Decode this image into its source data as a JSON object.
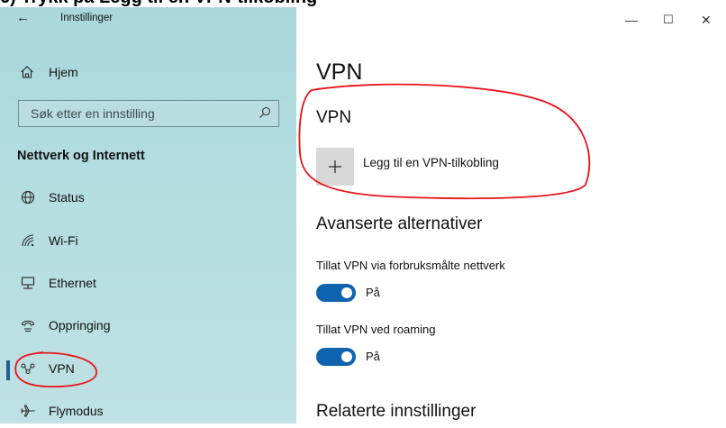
{
  "caption": {
    "text": "6) Trykk på Legg til en VPN-tilkobling"
  },
  "window": {
    "title": "Innstillinger",
    "controls": {
      "minimize": "—",
      "maximize": "☐",
      "close": "✕"
    }
  },
  "sidebar": {
    "home_label": "Hjem",
    "search_placeholder": "Søk etter en innstilling",
    "section_title": "Nettverk og Internett",
    "items": [
      {
        "label": "Status",
        "icon": "globe-icon"
      },
      {
        "label": "Wi-Fi",
        "icon": "wifi-icon"
      },
      {
        "label": "Ethernet",
        "icon": "ethernet-icon"
      },
      {
        "label": "Oppringing",
        "icon": "dialup-icon"
      },
      {
        "label": "VPN",
        "icon": "vpn-icon",
        "active": true
      },
      {
        "label": "Flymodus",
        "icon": "airplane-icon"
      }
    ]
  },
  "main": {
    "page_title": "VPN",
    "vpn_section_title": "VPN",
    "add_vpn_label": "Legg til en VPN-tilkobling",
    "advanced_title": "Avanserte alternativer",
    "options": [
      {
        "label": "Tillat VPN via forbruksmålte nettverk",
        "state": "På",
        "on": true
      },
      {
        "label": "Tillat VPN ved roaming",
        "state": "På",
        "on": true
      }
    ],
    "related_title": "Relaterte innstillinger"
  },
  "colors": {
    "accent": "#0f62ad",
    "sidebar_bg": "#b3dde0",
    "annotation": "#e8141c",
    "active_bar": "#1c5f96"
  }
}
